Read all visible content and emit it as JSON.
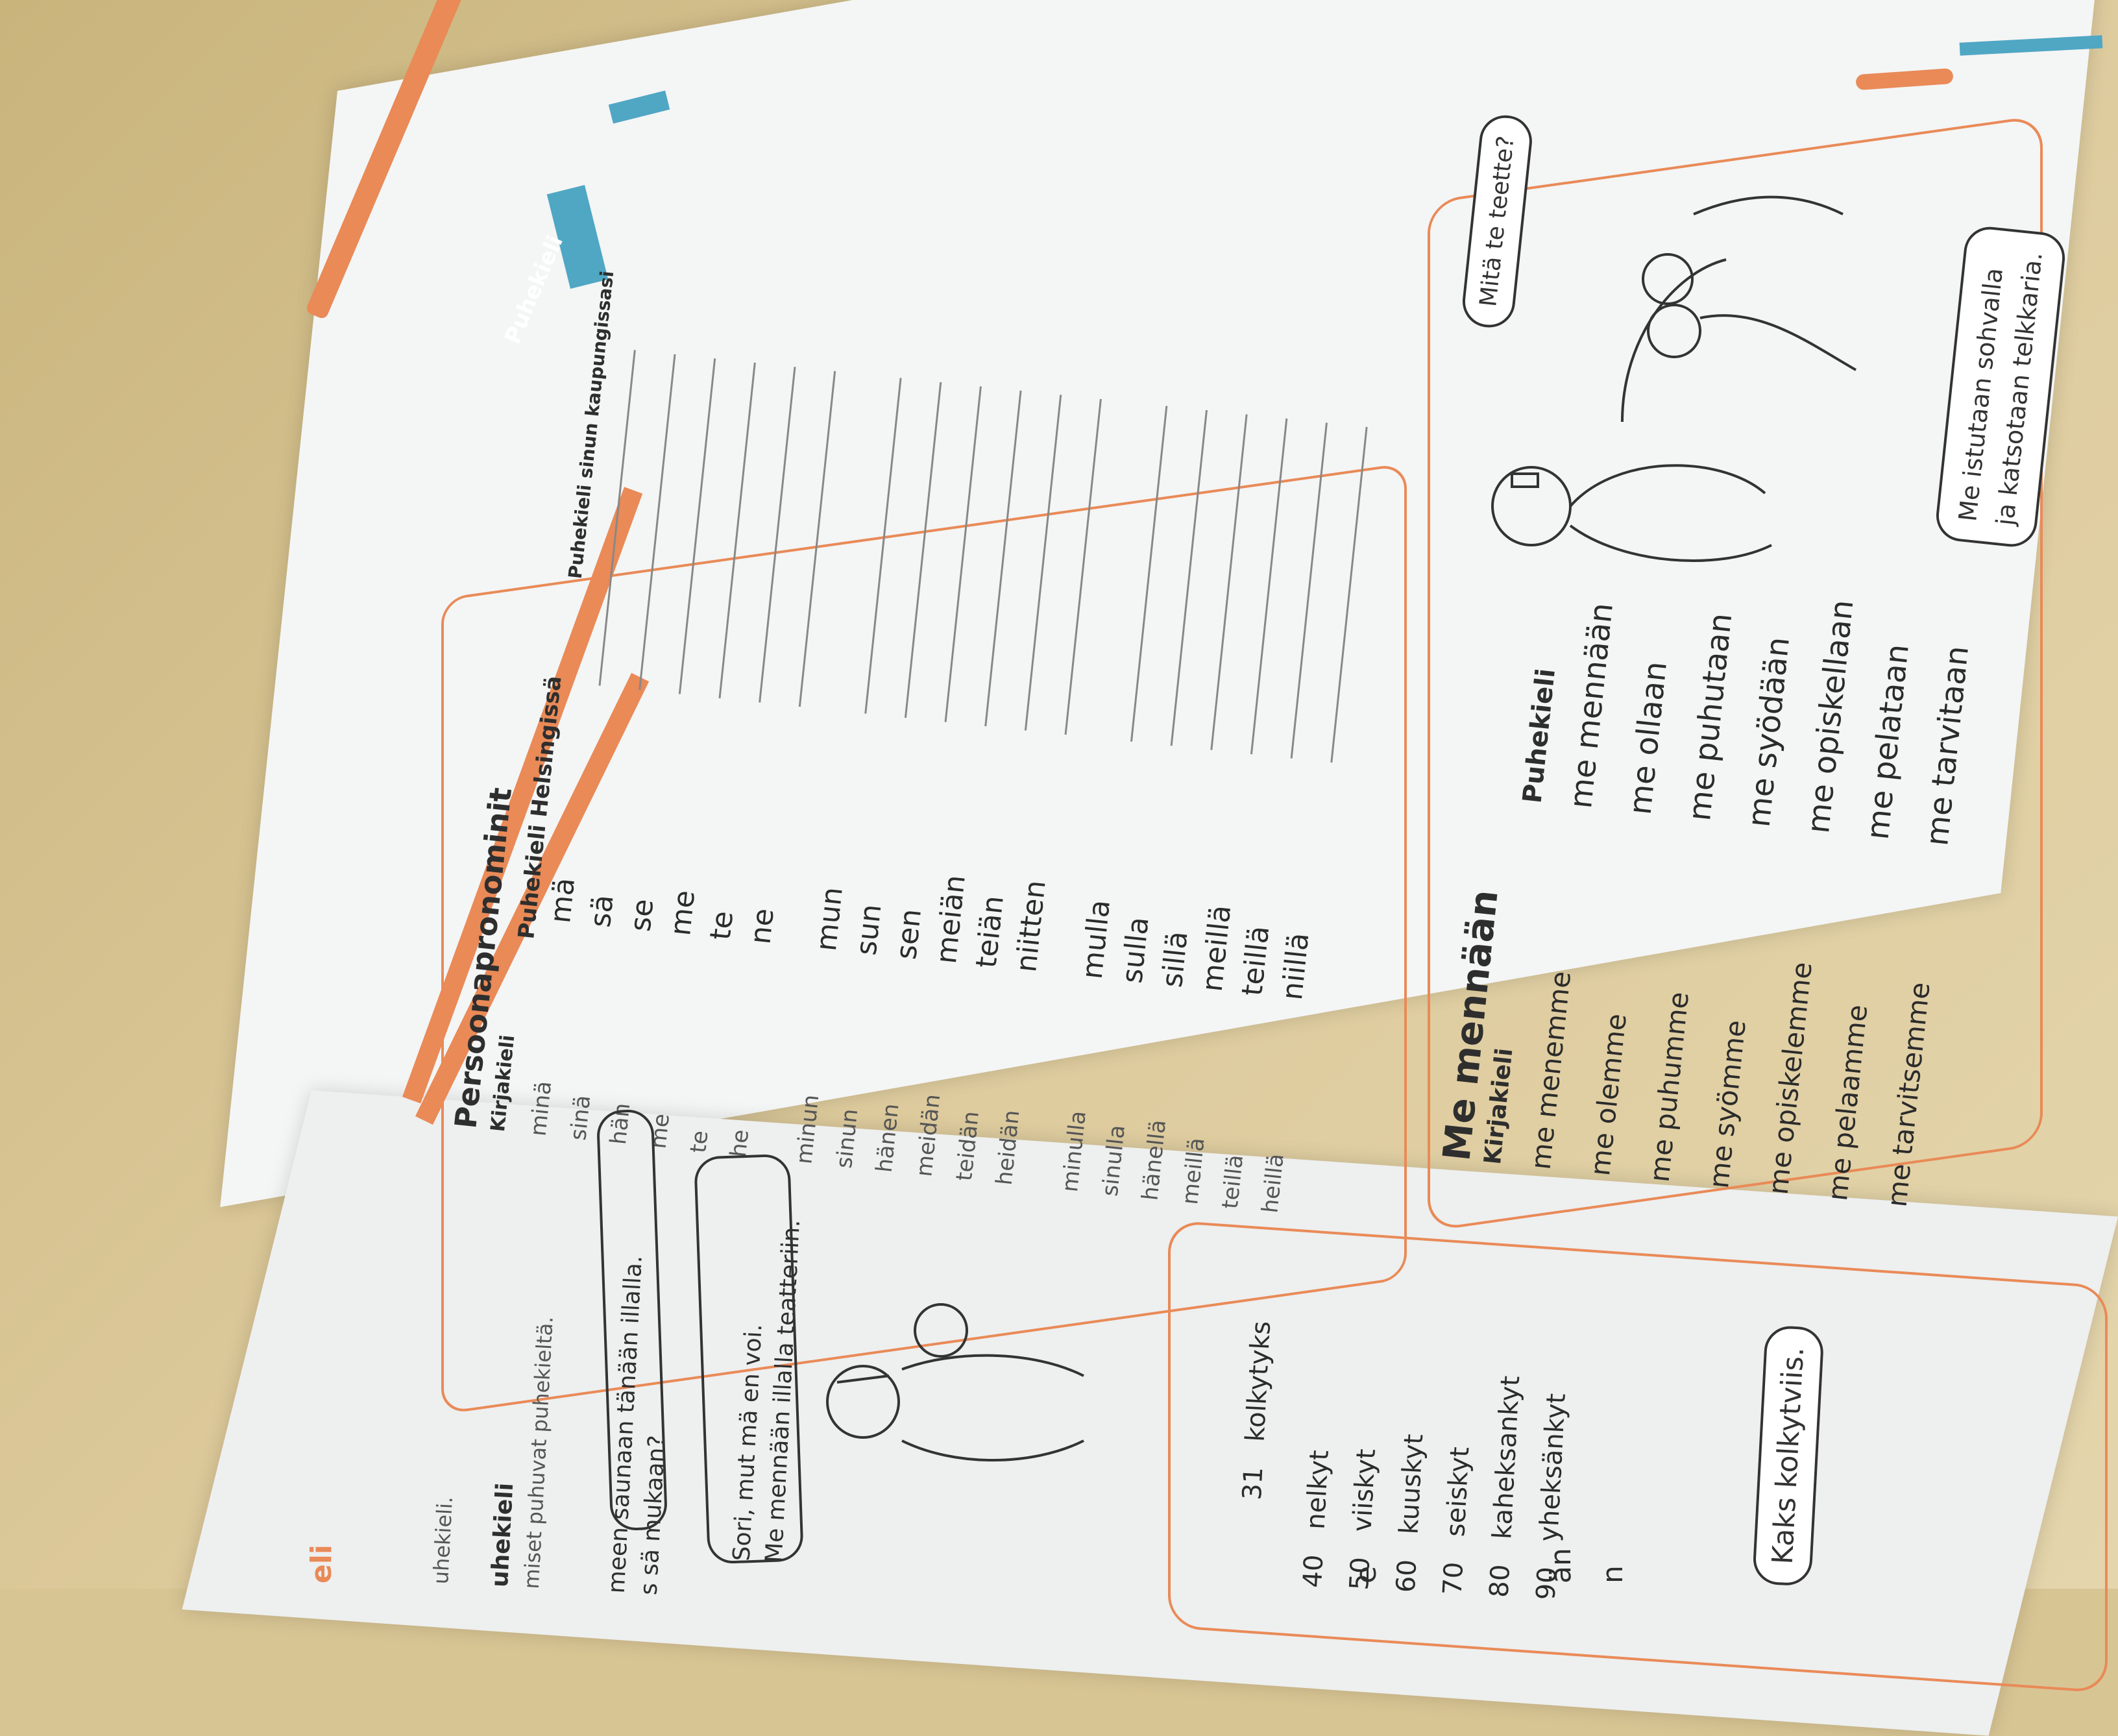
{
  "header_tab": "Puhekieli",
  "left_page": {
    "header_fragment": "eli",
    "intro_1": "uhekieli.",
    "section_title": "uhekieli",
    "intro_2": "miset puhuvat puhekieltä.",
    "bubble_1_line1": "meen saunaan tänään illalla.",
    "bubble_1_line2": "s sä mukaan?",
    "bubble_2_line1": "Sori, mut mä en voi.",
    "bubble_2_line2": "Me mennään illalla teatteriin.",
    "bubble_3": "Kaks kolkytviis.",
    "numbers": [
      {
        "n": "31",
        "w": "kolkytyks"
      },
      {
        "n": "40",
        "w": "nelkyt"
      },
      {
        "n": "50",
        "w": "viiskyt"
      },
      {
        "n": "60",
        "w": "kuuskyt"
      },
      {
        "n": "70",
        "w": "seiskyt"
      },
      {
        "n": "80",
        "w": "kaheksankyt"
      },
      {
        "n": "90",
        "w": "yheksänkyt"
      }
    ],
    "edge_fragments": [
      "e",
      "än",
      "n"
    ]
  },
  "persoonapronominit": {
    "title": "Persoonapronominit",
    "col_kirjakieli": "Kirjakieli",
    "col_helsinki": "Puhekieli Helsingissä",
    "col_oma": "Puhekieli sinun kaupungissasi",
    "kirjakieli": [
      "minä",
      "sinä",
      "hän",
      "me",
      "te",
      "he",
      "minun",
      "sinun",
      "hänen",
      "meidän",
      "teidän",
      "heidän",
      "minulla",
      "sinulla",
      "hänellä",
      "meillä",
      "teillä",
      "heillä"
    ],
    "helsinki": [
      "mä",
      "sä",
      "se",
      "me",
      "te",
      "ne",
      "mun",
      "sun",
      "sen",
      "meiän",
      "teiän",
      "niitten",
      "mulla",
      "sulla",
      "sillä",
      "meillä",
      "teillä",
      "niillä"
    ]
  },
  "me_mennaan": {
    "title": "Me mennään",
    "col_kirjakieli": "Kirjakieli",
    "col_puhekieli": "Puhekieli",
    "rows": [
      {
        "k": "me menemme",
        "p": "me mennään"
      },
      {
        "k": "me olemme",
        "p": "me ollaan"
      },
      {
        "k": "me puhumme",
        "p": "me puhutaan"
      },
      {
        "k": "me syömme",
        "p": "me syödään"
      },
      {
        "k": "me opiskelemme",
        "p": "me opiskellaan"
      },
      {
        "k": "me pelaamme",
        "p": "me pelataan"
      },
      {
        "k": "me tarvitsemme",
        "p": "me tarvitaan"
      }
    ],
    "bubble_question": "Mitä te teette?",
    "bubble_answer_line1": "Me istutaan sohvalla",
    "bubble_answer_line2": "ja katsotaan telkkaria."
  },
  "colors": {
    "accent": "#e98a57",
    "tab_blue": "#4fa7c4",
    "paper": "#f4f5f5",
    "table": "#d8c594"
  }
}
